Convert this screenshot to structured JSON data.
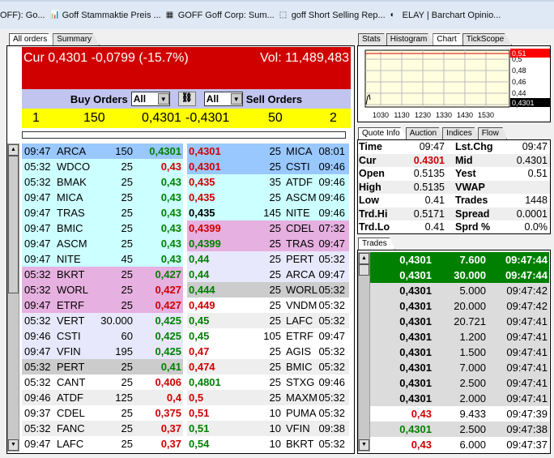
{
  "bookmarks": [
    {
      "label": "OFF): Go...",
      "icon": "none"
    },
    {
      "label": "Goff Stammaktie Preis ...",
      "icon": "bar-chart-icon"
    },
    {
      "label": "GOFF Goff Corp: Sum...",
      "icon": "otc-icon"
    },
    {
      "label": "goff Short Selling Rep...",
      "icon": "blank-page-icon"
    },
    {
      "label": "ELAY | Barchart Opinio...",
      "icon": "barchart-icon"
    }
  ],
  "left_tabs": [
    "All orders",
    "Summary"
  ],
  "header": {
    "cur": "Cur 0,4301 -0,0799 (-15.7%)",
    "vol": "Vol: 11,489,483",
    "color": "#d00000"
  },
  "filter": {
    "buy_label": "Buy Orders",
    "buy_select": "All",
    "sell_select": "All",
    "sell_label": "Sell Orders"
  },
  "summary": {
    "buy_count": "1",
    "buy_size": "150",
    "buy_price": "0,4301",
    "sell_price": "-0,4301",
    "sell_size": "50",
    "sell_count": "2"
  },
  "buy_orders": [
    [
      "09:47",
      "ARCA",
      "150",
      "0,4301",
      "g",
      "bl"
    ],
    [
      "05:32",
      "WDCO",
      "25",
      "0,43",
      "r",
      "cy"
    ],
    [
      "05:32",
      "BMAK",
      "25",
      "0,43",
      "g",
      "cy"
    ],
    [
      "09:47",
      "MICA",
      "25",
      "0,43",
      "g",
      "cy"
    ],
    [
      "09:47",
      "TRAS",
      "25",
      "0,43",
      "g",
      "cy"
    ],
    [
      "09:47",
      "BMIC",
      "25",
      "0,43",
      "g",
      "cy"
    ],
    [
      "09:47",
      "ASCM",
      "25",
      "0,43",
      "g",
      "cy"
    ],
    [
      "09:47",
      "NITE",
      "45",
      "0,43",
      "g",
      "cy"
    ],
    [
      "05:32",
      "BKRT",
      "25",
      "0,427",
      "g",
      "pk"
    ],
    [
      "05:32",
      "WORL",
      "25",
      "0,427",
      "r",
      "pk"
    ],
    [
      "09:47",
      "ETRF",
      "25",
      "0,427",
      "r",
      "pk"
    ],
    [
      "05:32",
      "VERT",
      "30.000",
      "0,425",
      "g",
      "lv"
    ],
    [
      "09:46",
      "CSTI",
      "60",
      "0,425",
      "g",
      "lv"
    ],
    [
      "09:47",
      "VFIN",
      "195",
      "0,425",
      "g",
      "lv"
    ],
    [
      "05:32",
      "PERT",
      "25",
      "0,41",
      "g",
      "gy"
    ],
    [
      "05:32",
      "CANT",
      "25",
      "0,406",
      "r",
      "wh"
    ],
    [
      "09:46",
      "ATDF",
      "125",
      "0,4",
      "r",
      "lg"
    ],
    [
      "09:37",
      "CDEL",
      "25",
      "0,375",
      "r",
      "wh"
    ],
    [
      "05:32",
      "FANC",
      "25",
      "0,37",
      "r",
      "lg"
    ],
    [
      "09:47",
      "LAFC",
      "25",
      "0,37",
      "r",
      "wh"
    ]
  ],
  "sell_orders": [
    [
      "0,4301",
      "25",
      "MICA",
      "08:01",
      "r",
      "bl"
    ],
    [
      "0,4301",
      "25",
      "CSTI",
      "09:46",
      "r",
      "bl"
    ],
    [
      "0,435",
      "35",
      "ATDF",
      "09:46",
      "r",
      "cy"
    ],
    [
      "0,435",
      "25",
      "ASCM",
      "09:46",
      "r",
      "cy"
    ],
    [
      "0,435",
      "145",
      "NITE",
      "09:46",
      "k",
      "cy"
    ],
    [
      "0,4399",
      "25",
      "CDEL",
      "07:32",
      "r",
      "pk"
    ],
    [
      "0,4399",
      "25",
      "TRAS",
      "09:47",
      "g",
      "pk"
    ],
    [
      "0,44",
      "25",
      "PERT",
      "05:32",
      "g",
      "lv"
    ],
    [
      "0,44",
      "25",
      "ARCA",
      "09:47",
      "g",
      "lv"
    ],
    [
      "0,444",
      "25",
      "WORL",
      "05:32",
      "g",
      "gy"
    ],
    [
      "0,449",
      "25",
      "VNDM",
      "05:32",
      "r",
      "wh"
    ],
    [
      "0,45",
      "25",
      "LAFC",
      "05:32",
      "g",
      "lg"
    ],
    [
      "0,45",
      "105",
      "ETRF",
      "09:47",
      "g",
      "wh"
    ],
    [
      "0,47",
      "25",
      "AGIS",
      "05:32",
      "r",
      "wh"
    ],
    [
      "0,474",
      "25",
      "BMIC",
      "05:32",
      "r",
      "lg"
    ],
    [
      "0,4801",
      "25",
      "STXG",
      "09:46",
      "g",
      "wh"
    ],
    [
      "0,5",
      "25",
      "MAXM",
      "05:32",
      "r",
      "lg"
    ],
    [
      "0,51",
      "10",
      "PUMA",
      "05:32",
      "r",
      "wh"
    ],
    [
      "0,51",
      "10",
      "VFIN",
      "09:38",
      "g",
      "lg"
    ],
    [
      "0,54",
      "10",
      "BKRT",
      "05:32",
      "g",
      "wh"
    ]
  ],
  "chart_tabs": [
    "Stats",
    "Histogram",
    "Chart",
    "TickScope"
  ],
  "chart": {
    "x_ticks": [
      "1030",
      "1130",
      "1230",
      "1330",
      "1430",
      "1530"
    ],
    "y_ticks": [
      "0,42",
      "0,44",
      "0,46",
      "0,48",
      "0,5"
    ],
    "high_label": "0,51",
    "cur_label": "0,4301"
  },
  "quote_tabs": [
    "Quote Info",
    "Auction",
    "Indices",
    "Flow"
  ],
  "quote": [
    [
      "Time",
      "09:47",
      "Lst.Chg",
      "09:47"
    ],
    [
      "Cur",
      "0.4301",
      "Mid",
      "0.4301"
    ],
    [
      "Open",
      "0.5135",
      "Yest",
      "0.51"
    ],
    [
      "High",
      "0.5135",
      "VWAP",
      ""
    ],
    [
      "Low",
      "0.41",
      "Trades",
      "1448"
    ],
    [
      "Trd.Hi",
      "0.5171",
      "Spread",
      "0.0001"
    ],
    [
      "Trd.Lo",
      "0.41",
      "Sprd %",
      "0.0%"
    ]
  ],
  "trades_tab": "Trades",
  "trades": [
    [
      "0,4301",
      "7.600",
      "09:47:44",
      "w",
      "gr"
    ],
    [
      "0,4301",
      "30.000",
      "09:47:44",
      "w",
      "gr"
    ],
    [
      "0,4301",
      "5.000",
      "09:47:42",
      "k",
      "dg"
    ],
    [
      "0,4301",
      "20.000",
      "09:47:42",
      "k",
      "dg"
    ],
    [
      "0,4301",
      "20.721",
      "09:47:41",
      "k",
      "dg"
    ],
    [
      "0,4301",
      "1.200",
      "09:47:41",
      "k",
      "dg"
    ],
    [
      "0,4301",
      "1.500",
      "09:47:41",
      "k",
      "dg"
    ],
    [
      "0,4301",
      "7.000",
      "09:47:41",
      "k",
      "dg"
    ],
    [
      "0,4301",
      "2.500",
      "09:47:41",
      "k",
      "dg"
    ],
    [
      "0,4301",
      "2.000",
      "09:47:41",
      "k",
      "dg"
    ],
    [
      "0,43",
      "9.433",
      "09:47:39",
      "r",
      "wh"
    ],
    [
      "0,4301",
      "2.500",
      "09:47:38",
      "g",
      "dg"
    ],
    [
      "0,43",
      "6.000",
      "09:47:37",
      "r",
      "wh"
    ]
  ]
}
